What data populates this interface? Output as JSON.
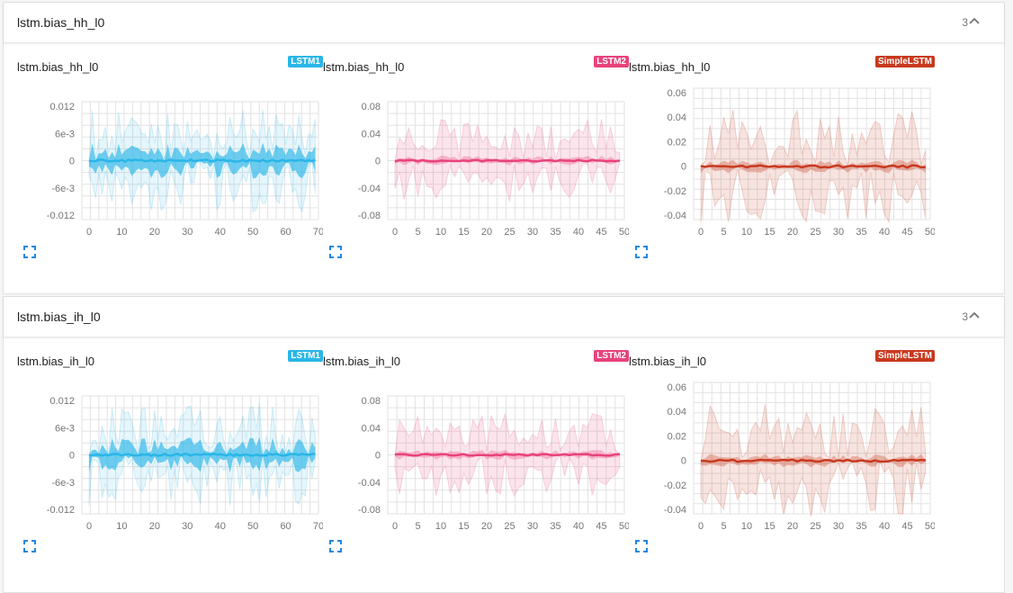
{
  "sections": [
    {
      "title": "lstm.bias_hh_l0",
      "count": "3",
      "cards": [
        {
          "title": "lstm.bias_hh_l0",
          "tag": "LSTM1",
          "color": "#29b6e8",
          "x_ticks": [
            "0",
            "10",
            "20",
            "30",
            "40",
            "50",
            "60",
            "70"
          ],
          "y_ticks": [
            "0.012",
            "6e-3",
            "0",
            "-6e-3",
            "-0.012"
          ],
          "chart_data": {
            "type": "area",
            "x_range": [
              0,
              69
            ],
            "y_range": [
              -0.012,
              0.012
            ],
            "series_name": "LSTM1"
          }
        },
        {
          "title": "lstm.bias_hh_l0",
          "tag": "LSTM2",
          "color": "#e8427c",
          "x_ticks": [
            "0",
            "5",
            "10",
            "15",
            "20",
            "25",
            "30",
            "35",
            "40",
            "45",
            "50"
          ],
          "y_ticks": [
            "0.08",
            "0.04",
            "0",
            "-0.04",
            "-0.08"
          ],
          "chart_data": {
            "type": "area",
            "x_range": [
              0,
              49
            ],
            "y_range": [
              -0.08,
              0.08
            ],
            "series_name": "LSTM2"
          }
        },
        {
          "title": "lstm.bias_hh_l0",
          "tag": "SimpleLSTM",
          "color": "#c8391e",
          "x_ticks": [
            "0",
            "5",
            "10",
            "15",
            "20",
            "25",
            "30",
            "35",
            "40",
            "45",
            "50"
          ],
          "y_ticks": [
            "0.06",
            "0.04",
            "0.02",
            "0",
            "-0.02",
            "-0.04"
          ],
          "chart_data": {
            "type": "area",
            "x_range": [
              0,
              49
            ],
            "y_range": [
              -0.04,
              0.06
            ],
            "series_name": "SimpleLSTM"
          }
        }
      ]
    },
    {
      "title": "lstm.bias_ih_l0",
      "count": "3",
      "cards": [
        {
          "title": "lstm.bias_ih_l0",
          "tag": "LSTM1",
          "color": "#29b6e8",
          "x_ticks": [
            "0",
            "10",
            "20",
            "30",
            "40",
            "50",
            "60",
            "70"
          ],
          "y_ticks": [
            "0.012",
            "6e-3",
            "0",
            "-6e-3",
            "-0.012"
          ],
          "chart_data": {
            "type": "area",
            "x_range": [
              0,
              69
            ],
            "y_range": [
              -0.012,
              0.012
            ],
            "series_name": "LSTM1"
          }
        },
        {
          "title": "lstm.bias_ih_l0",
          "tag": "LSTM2",
          "color": "#e8427c",
          "x_ticks": [
            "0",
            "5",
            "10",
            "15",
            "20",
            "25",
            "30",
            "35",
            "40",
            "45",
            "50"
          ],
          "y_ticks": [
            "0.08",
            "0.04",
            "0",
            "-0.04",
            "-0.08"
          ],
          "chart_data": {
            "type": "area",
            "x_range": [
              0,
              49
            ],
            "y_range": [
              -0.08,
              0.08
            ],
            "series_name": "LSTM2"
          }
        },
        {
          "title": "lstm.bias_ih_l0",
          "tag": "SimpleLSTM",
          "color": "#c8391e",
          "x_ticks": [
            "0",
            "5",
            "10",
            "15",
            "20",
            "25",
            "30",
            "35",
            "40",
            "45",
            "50"
          ],
          "y_ticks": [
            "0.06",
            "0.04",
            "0.02",
            "0",
            "-0.02",
            "-0.04"
          ],
          "chart_data": {
            "type": "area",
            "x_range": [
              0,
              49
            ],
            "y_range": [
              -0.04,
              0.06
            ],
            "series_name": "SimpleLSTM"
          }
        }
      ]
    }
  ]
}
